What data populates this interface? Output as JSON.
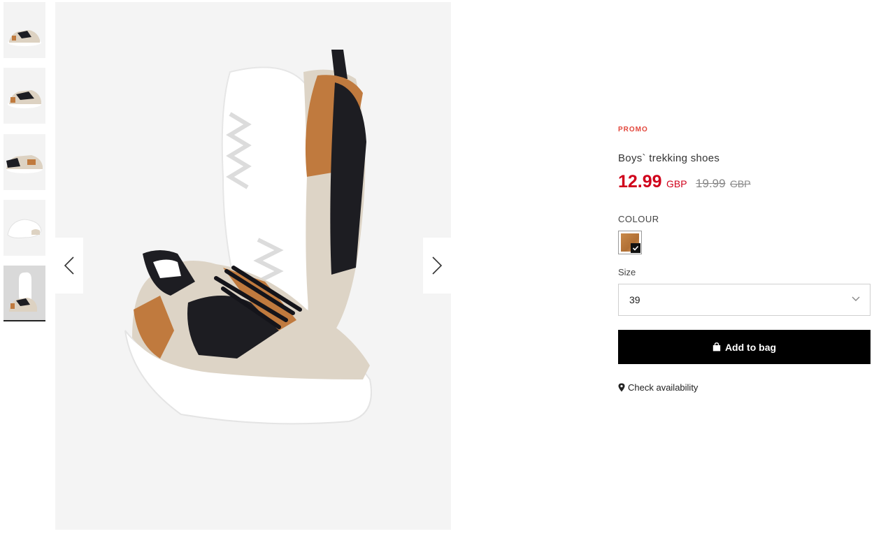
{
  "gallery": {
    "thumbnails": [
      {
        "name": "thumb-1"
      },
      {
        "name": "thumb-2"
      },
      {
        "name": "thumb-3"
      },
      {
        "name": "thumb-4"
      },
      {
        "name": "thumb-5",
        "active": true
      }
    ],
    "prev_icon": "chevron-left-icon",
    "next_icon": "chevron-right-icon"
  },
  "product": {
    "badge": "PROMO",
    "title": "Boys` trekking shoes",
    "price": "12.99",
    "currency": "GBP",
    "old_price": "19.99",
    "old_currency": "GBP",
    "colour_label": "COLOUR",
    "selected_colour": "#c07a3e",
    "size_label": "Size",
    "size_value": "39",
    "add_to_bag": "Add to bag",
    "check_availability": "Check availability"
  },
  "colors": {
    "promo": "#e2463b",
    "price": "#d0021b",
    "button_bg": "#000000"
  }
}
